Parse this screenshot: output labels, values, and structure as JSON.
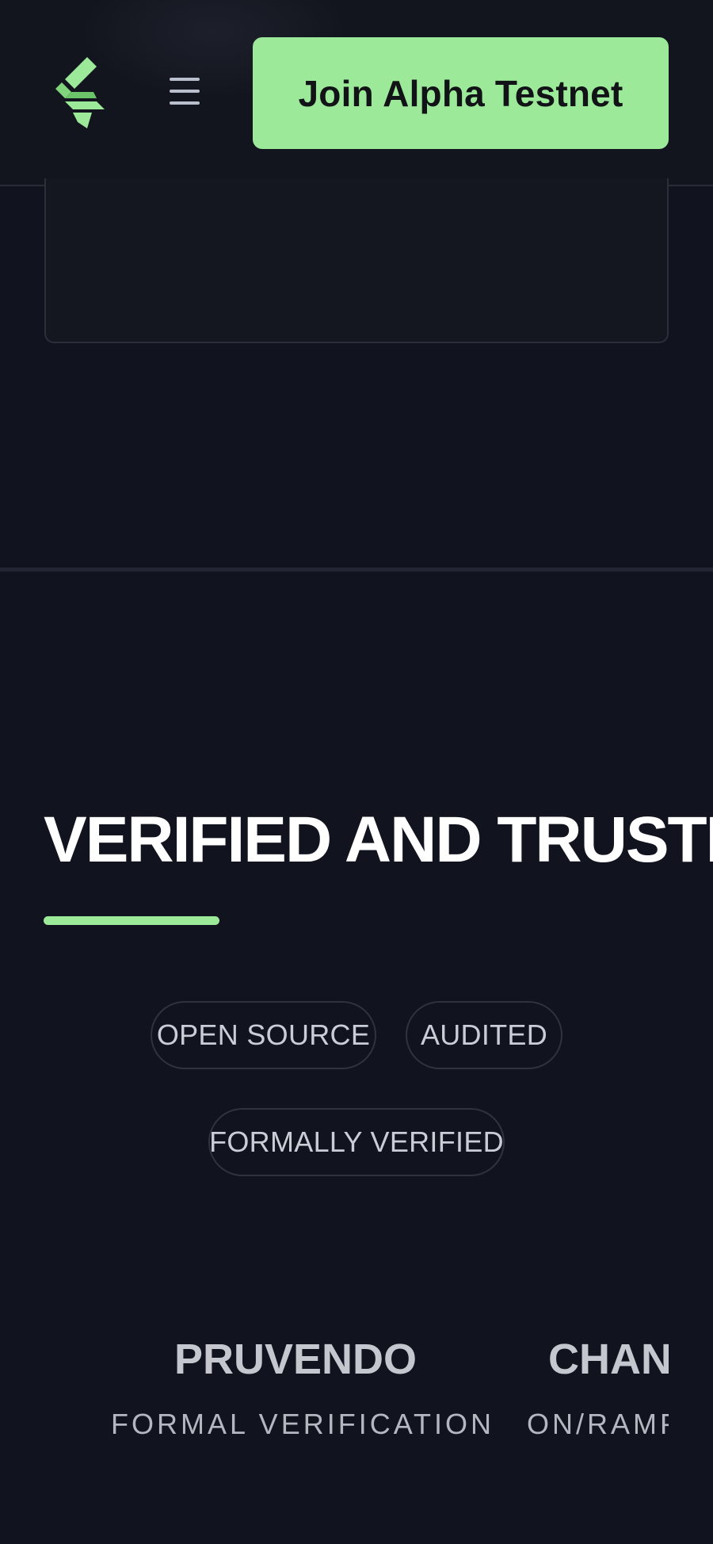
{
  "header": {
    "logo_name": "brand-logo",
    "menu_icon": "hamburger-menu-icon",
    "cta_label": "Join Alpha Testnet"
  },
  "section": {
    "title": "VERIFIED AND TRUSTED",
    "badges": [
      "OPEN SOURCE",
      "AUDITED",
      "FORMALLY VERIFIED"
    ]
  },
  "partners": [
    {
      "name": "PRUVENDO",
      "subtitle": "FORMAL VERIFICATION"
    },
    {
      "name": "CHANG",
      "subtitle": "ON/RAMP"
    }
  ],
  "colors": {
    "background": "#11131e",
    "accent": "#9de99a",
    "text": "#ffffff",
    "muted_text": "#c9cdd6",
    "border": "#30333e"
  }
}
